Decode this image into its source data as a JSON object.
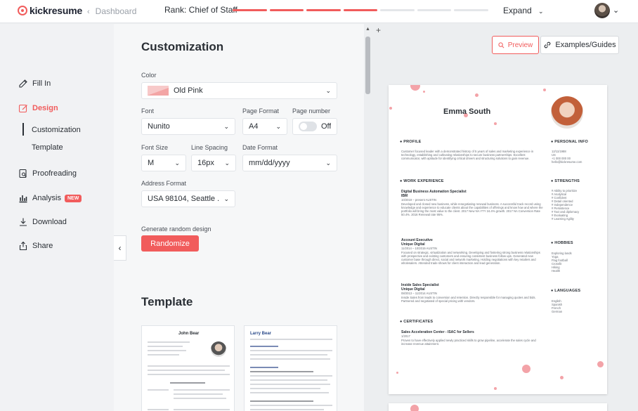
{
  "app": {
    "logo": "kickresume",
    "back_label": "Dashboard"
  },
  "topbar": {
    "rank_label": "Rank: Chief of Staff",
    "rank_segments_filled": 4,
    "rank_segments_total": 7,
    "expand_label": "Expand"
  },
  "colors": {
    "accent": "#f15c5c",
    "dot_pink": "#f3a3a8"
  },
  "nav": {
    "items": [
      {
        "label": "Fill In",
        "icon": "pencil-icon",
        "active": false
      },
      {
        "label": "Design",
        "icon": "design-icon",
        "active": true
      },
      {
        "label": "Proofreading",
        "icon": "proofread-icon",
        "active": false
      },
      {
        "label": "Analysis",
        "icon": "chart-icon",
        "active": false,
        "badge": "NEW"
      },
      {
        "label": "Download",
        "icon": "download-icon",
        "active": false
      },
      {
        "label": "Share",
        "icon": "share-icon",
        "active": false
      }
    ],
    "sub_items": [
      {
        "label": "Customization",
        "active": true
      },
      {
        "label": "Template",
        "active": false
      }
    ]
  },
  "customization": {
    "title": "Customization",
    "color": {
      "label": "Color",
      "value": "Old Pink"
    },
    "font": {
      "label": "Font",
      "value": "Nunito"
    },
    "page_format": {
      "label": "Page Format",
      "value": "A4"
    },
    "page_number": {
      "label": "Page number",
      "value": "Off"
    },
    "font_size": {
      "label": "Font Size",
      "value": "M"
    },
    "line_spacing": {
      "label": "Line Spacing",
      "value": "16px"
    },
    "date_format": {
      "label": "Date Format",
      "value": "mm/dd/yyyy"
    },
    "address_format": {
      "label": "Address Format",
      "value": "USA 98104, Seattle ..."
    },
    "random": {
      "label": "Generate random design",
      "button": "Randomize"
    }
  },
  "template": {
    "title": "Template",
    "cards": [
      {
        "name": "John Bear"
      },
      {
        "name": "Larry Bear"
      }
    ]
  },
  "preview": {
    "preview_label": "Preview",
    "examples_label": "Examples/Guides"
  },
  "resume": {
    "name": "Emma South",
    "profile_h": "PROFILE",
    "profile_text": "Customer focused leader with a demonstrated history of 5 years of sales and marketing experience in technology, establishing and cultivating relationships to secure business partnerships. Excellent communicator, with aptitude for identifying critical drivers and structuring solutions to gain revenue.",
    "work_h": "WORK EXPERIENCE",
    "job1_title": "Digital Business Automation Specialist",
    "job1_company": "IBM",
    "job1_date": "10/2019 – present   AUSTIN",
    "job1_text": "Developed and closed new business, while renegotiating renewal business. A successful track record using knowledge and experience to educate clients about the capabilities of offerings and know how and where the portfolio will bring the most value to the client. 2017 New NA YTY 24.4% growth. 2017 NA Conversion Rate 50.4%. 2016 Renewal rate 95%.",
    "job2_title": "Account Executive",
    "job2_company": "Unique Digital",
    "job2_date": "11/2014 – 10/2019   AUSTIN",
    "job2_text": "Focused on strategic, virtualization and networking. Developing and fostering strong business relationships with prospective and existing customers and ensuring consistent business follow ups. Generated new customer base through direct, social and network marketing. Holding negotiations with key retailers and wholesalers. Attended trade shows for client interaction and lead generation.",
    "job3_title": "Inside Sales Specialist",
    "job3_company": "Unique Digital",
    "job3_date": "08/2013 – 11/2014   AUSTIN",
    "job3_text": "Inside Sales from leads to conversion and retention. Directly responsible for managing quotes and bids. Partnered and negotiated of special pricing with vendors.",
    "cert_h": "CERTIFICATES",
    "cert_title": "Sales Acceleration Center - ISAC for Sellers",
    "cert_date": "1/2017",
    "cert_text": "Proven to have effectively applied newly practiced skills to grow pipeline, accelerate the sales cycle and increase revenue attainment.",
    "personal_h": "PERSONAL INFO",
    "personal_text": "12/11/1988\nUS\n+1 000 000 00\nhello@kickresume.com",
    "strengths_h": "STRENGTHS",
    "strengths_text": "# Ability to prioritize\n# Analytical\n# Confident\n# Detail oriented\n# Independence\n# Persistence\n# Tact and diplomacy\n# Evaluating\n# Learning Agility",
    "hobbies_h": "HOBBIES",
    "hobbies_text": "Exploring lands\nYoga\nFlag football\nCrossfit\nHiking\nHealth",
    "languages_h": "LANGUAGES",
    "languages_text": "English\nSpanish\nFrench\nGerman"
  }
}
